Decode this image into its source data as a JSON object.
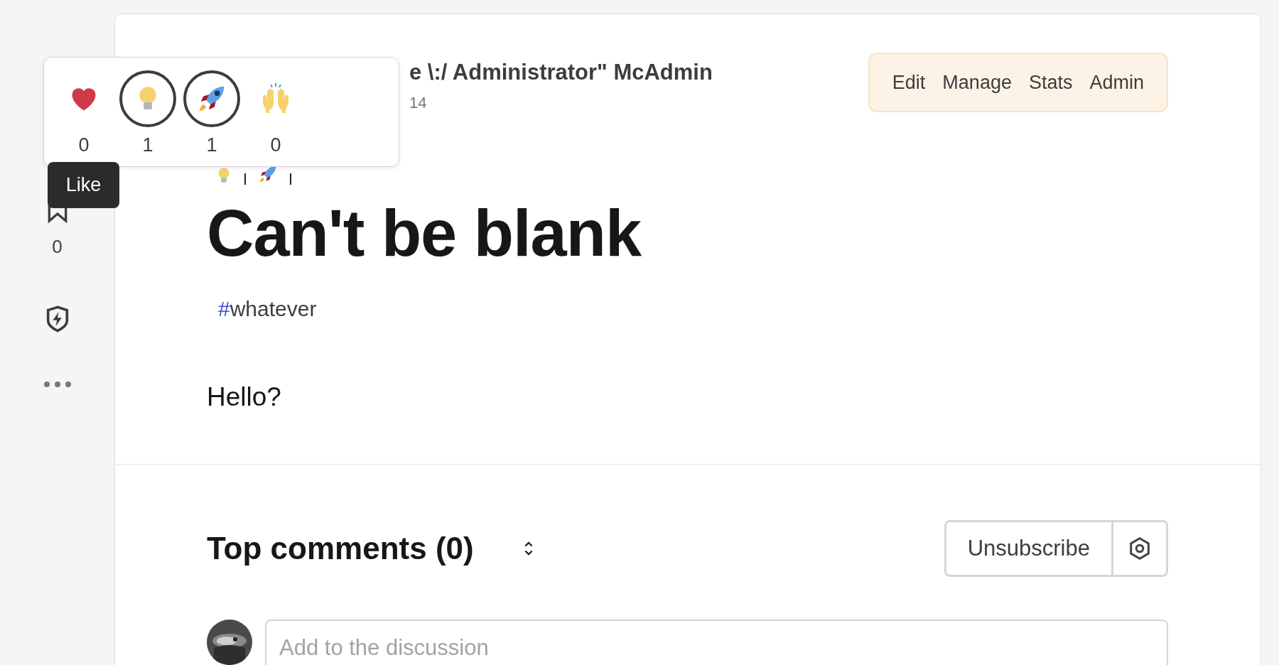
{
  "sidebar": {
    "actions": [
      {
        "kind": "like"
      },
      {
        "kind": "bookmark",
        "count": "0"
      },
      {
        "kind": "boost"
      },
      {
        "kind": "more"
      }
    ]
  },
  "reaction_popover": {
    "reactions": [
      {
        "kind": "heart",
        "count": "0",
        "selected": false
      },
      {
        "kind": "bulb",
        "count": "1",
        "selected": true
      },
      {
        "kind": "rocket",
        "count": "1",
        "selected": true
      },
      {
        "kind": "hands",
        "count": "0",
        "selected": false
      }
    ]
  },
  "tooltip": "Like",
  "article": {
    "author": "e \\:/ Administrator\" McAdmin",
    "date": "14",
    "actions": [
      "Edit",
      "Manage",
      "Stats",
      "Admin"
    ],
    "reaction_summary": [
      {
        "kind": "bulb"
      },
      {
        "kind": "rocket"
      }
    ],
    "title": "Can't be blank",
    "tags": [
      {
        "hash": "#",
        "name": "whatever"
      }
    ],
    "body": "Hello?"
  },
  "comments": {
    "heading": "Top comments (0)",
    "subscribe_button": "Unsubscribe",
    "placeholder": "Add to the discussion"
  }
}
